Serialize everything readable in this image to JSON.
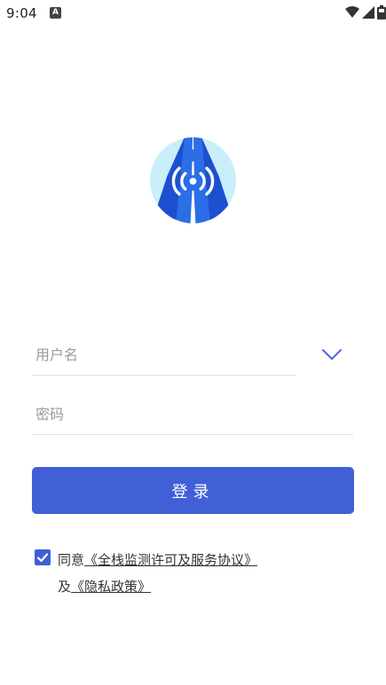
{
  "status_bar": {
    "time": "9:04",
    "notification_icon": "A",
    "icons": [
      "wifi-icon",
      "signal-icon",
      "battery-icon"
    ]
  },
  "logo": {
    "icon": "road-signal-logo",
    "colors": {
      "circle": "#c9eefa",
      "road": "#2b6ee6",
      "road_dark": "#1e4fd0",
      "lane": "#ffffff"
    }
  },
  "form": {
    "username_placeholder": "用户名",
    "password_placeholder": "密码",
    "dropdown_icon": "chevron-down-icon"
  },
  "login_button": {
    "label": "登录"
  },
  "agreement": {
    "checked": true,
    "prefix": "同意",
    "service_link": "《全栈监测许可及服务协议》",
    "conjunction": "及",
    "privacy_link": "《隐私政策》"
  },
  "colors": {
    "accent": "#4160d8",
    "divider": "#e2e2e2",
    "placeholder": "#9a9a9a"
  }
}
